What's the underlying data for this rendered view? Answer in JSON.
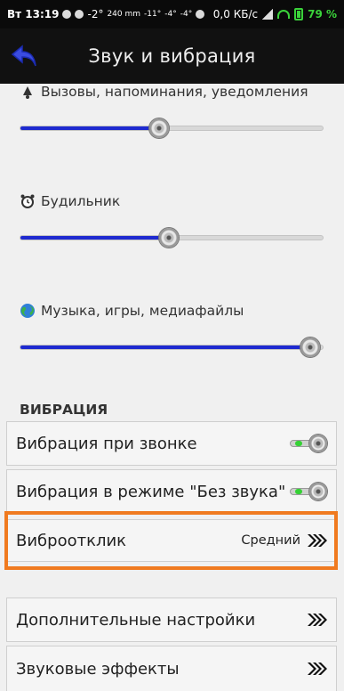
{
  "status_bar": {
    "time": "Вт 13:19",
    "indicators": [
      "-2°",
      "240 mm",
      "-11°",
      "-4°",
      "-4°"
    ],
    "net_speed": "0,0 КБ/с",
    "battery": "79 %"
  },
  "header": {
    "back_icon": "back-arrow-icon",
    "title": "Звук и вибрация"
  },
  "volume": {
    "calls": {
      "label": "Вызовы, напоминания, уведомления",
      "level": 0.46,
      "icon": "bell-icon"
    },
    "alarm": {
      "label": "Будильник",
      "level": 0.49,
      "icon": "alarm-clock-icon"
    },
    "media": {
      "label": "Музыка, игры, медиафайлы",
      "level": 0.96,
      "icon": "globe-icon"
    }
  },
  "vibration": {
    "section_title": "ВИБРАЦИЯ",
    "items": [
      {
        "label": "Вибрация при звонке",
        "type": "toggle",
        "state": "on"
      },
      {
        "label": "Вибрация в режиме \"Без звука\"",
        "type": "toggle",
        "state": "on"
      },
      {
        "label": "Виброотклик",
        "type": "value",
        "value": "Средний",
        "icon": "arrow-right-icon"
      }
    ]
  },
  "more": [
    {
      "label": "Дополнительные настройки",
      "icon": "arrow-right-icon"
    },
    {
      "label": "Звуковые эффекты",
      "icon": "arrow-right-icon"
    }
  ],
  "colors": {
    "slider_fill": "#1e2ad0",
    "highlight": "#f07a1f",
    "battery_green": "#3ad23a"
  }
}
